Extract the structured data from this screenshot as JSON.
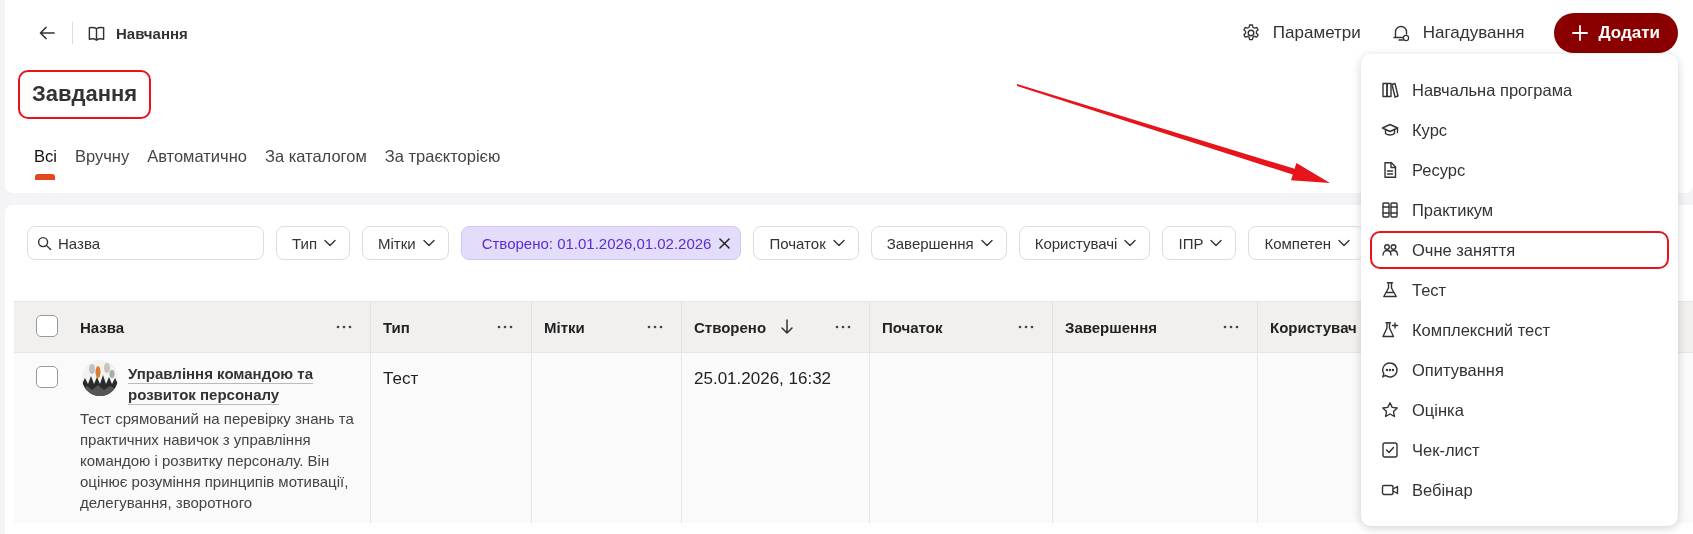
{
  "top_bar": {
    "breadcrumb": "Навчання",
    "actions": [
      {
        "label": "Параметри"
      },
      {
        "label": "Нагадування"
      }
    ],
    "add_button": "Додати"
  },
  "title": {
    "text": "Завдання",
    "highlighted": true
  },
  "tabs": [
    {
      "label": "Всі",
      "selected": true
    },
    {
      "label": "Вручну",
      "selected": false
    },
    {
      "label": "Автоматично",
      "selected": false
    },
    {
      "label": "За каталогом",
      "selected": false
    },
    {
      "label": "За траєкторією",
      "selected": false
    }
  ],
  "filters": [
    {
      "kind": "search",
      "placeholder": "Назва"
    },
    {
      "kind": "dropdown",
      "label": "Тип"
    },
    {
      "kind": "dropdown",
      "label": "Мітки"
    },
    {
      "kind": "active",
      "label": "Створено: 01.01.2026,01.02.2026"
    },
    {
      "kind": "dropdown",
      "label": "Початок"
    },
    {
      "kind": "dropdown",
      "label": "Завершення"
    },
    {
      "kind": "dropdown",
      "label": "Користувачі"
    },
    {
      "kind": "dropdown",
      "label": "ІПР"
    },
    {
      "kind": "dropdown",
      "label": "Компетен"
    }
  ],
  "table": {
    "all_checked": false,
    "columns": [
      {
        "label": "Назва",
        "sorted": false
      },
      {
        "label": "Тип",
        "sorted": false
      },
      {
        "label": "Мітки",
        "sorted": false
      },
      {
        "label": "Створено",
        "sorted": true
      },
      {
        "label": "Початок",
        "sorted": false
      },
      {
        "label": "Завершення",
        "sorted": false
      },
      {
        "label": "Користувач",
        "sorted": false
      }
    ],
    "rows": [
      {
        "checked": false,
        "title": "Управління командою та розвиток персоналу",
        "description": "Тест срямований на перевірку знань та практичних навичок з управління командою і розвитку персоналу. Він оцінює розуміння принципів мотивації, делегування, зворотного",
        "type": "Тест",
        "created": "25.01.2026, 16:32"
      }
    ]
  },
  "add_menu": {
    "items": [
      {
        "label": "Навчальна програма",
        "highlighted": false
      },
      {
        "label": "Курс",
        "highlighted": false
      },
      {
        "label": "Ресурс",
        "highlighted": false
      },
      {
        "label": "Практикум",
        "highlighted": false
      },
      {
        "label": "Очне заняття",
        "highlighted": true
      },
      {
        "label": "Тест",
        "highlighted": false
      },
      {
        "label": "Комплексний тест",
        "highlighted": false
      },
      {
        "label": "Опитування",
        "highlighted": false
      },
      {
        "label": "Оцінка",
        "highlighted": false
      },
      {
        "label": "Чек-лист",
        "highlighted": false
      },
      {
        "label": "Вебінар",
        "highlighted": false
      }
    ]
  }
}
